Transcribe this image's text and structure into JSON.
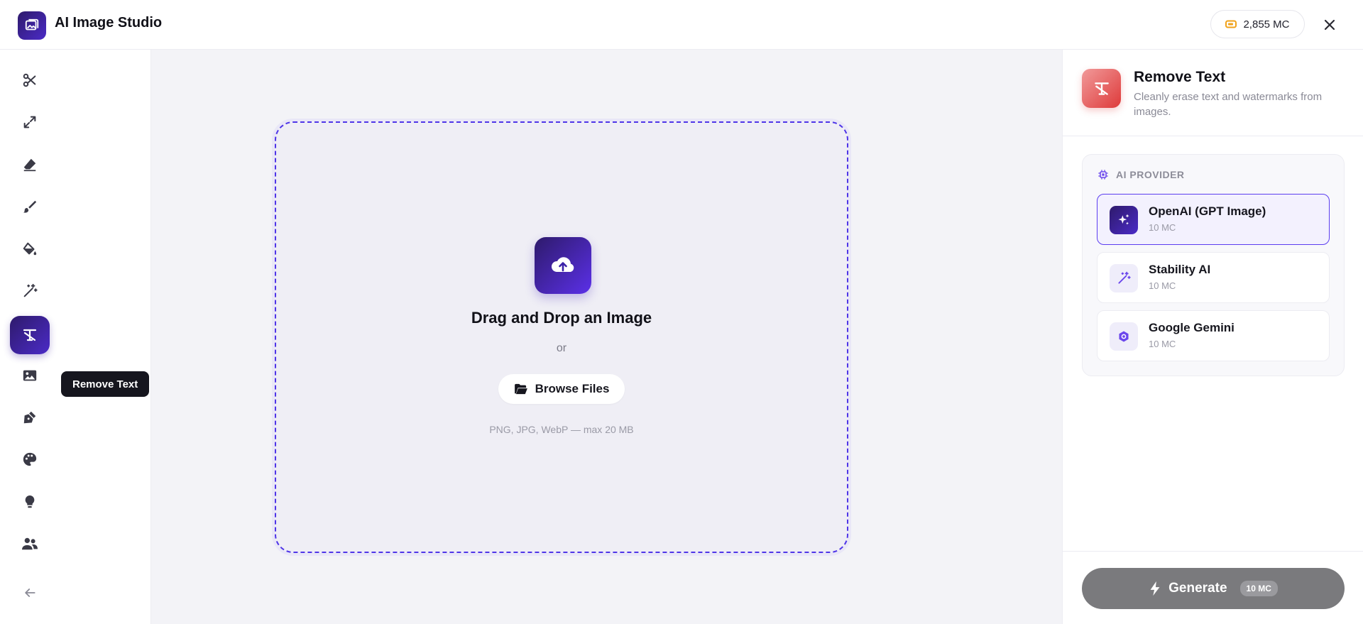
{
  "header": {
    "app_title": "AI Image Studio",
    "credits": "2,855 MC",
    "logo_icon": "image-icon",
    "coin_icon": "coin-icon",
    "close_icon": "close-icon"
  },
  "sidebar": {
    "items": [
      {
        "name": "scissors-icon"
      },
      {
        "name": "expand-icon"
      },
      {
        "name": "eraser-icon"
      },
      {
        "name": "brush-icon"
      },
      {
        "name": "fill-icon"
      },
      {
        "name": "magic-wand-icon"
      },
      {
        "name": "remove-text-icon",
        "active": true
      },
      {
        "name": "image-icon"
      },
      {
        "name": "pen-icon"
      },
      {
        "name": "palette-icon"
      },
      {
        "name": "lightbulb-icon"
      },
      {
        "name": "users-icon"
      }
    ],
    "tooltip": "Remove Text",
    "collapse_icon": "arrow-left-icon"
  },
  "dropzone": {
    "title": "Drag and Drop an Image",
    "or": "or",
    "browse_label": "Browse Files",
    "formats": "PNG, JPG, WebP — max 20 MB"
  },
  "panel": {
    "tool_title": "Remove Text",
    "tool_desc": "Cleanly erase text and watermarks from images.",
    "provider_label": "AI PROVIDER",
    "providers": [
      {
        "name": "OpenAI (GPT Image)",
        "cost": "10 MC",
        "selected": true,
        "icon": "sparkles-icon"
      },
      {
        "name": "Stability AI",
        "cost": "10 MC",
        "selected": false,
        "icon": "magic-wand-icon"
      },
      {
        "name": "Google Gemini",
        "cost": "10 MC",
        "selected": false,
        "icon": "gemini-icon"
      }
    ],
    "generate_label": "Generate",
    "generate_cost": "10 MC"
  },
  "colors": {
    "accent": "#4b2bc7",
    "dropzone_border": "#4f35e8",
    "tool_icon": "#de3a3a",
    "generate_disabled": "#7a7a7d"
  }
}
